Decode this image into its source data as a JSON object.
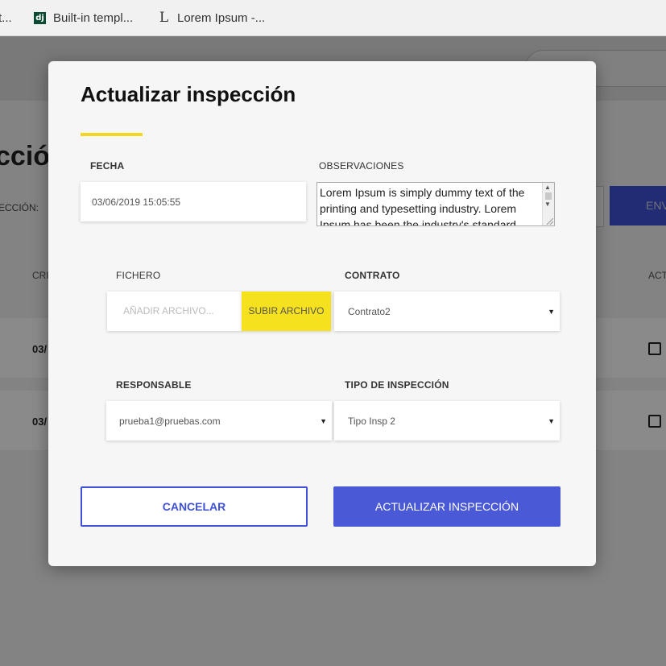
{
  "browser": {
    "bookmarks": [
      {
        "icon": "page-icon",
        "label": "t..."
      },
      {
        "icon": "django-icon",
        "label": "Built-in templ..."
      },
      {
        "icon": "lorem-ipsum-icon",
        "label": "Lorem Ipsum -..."
      }
    ]
  },
  "background_page": {
    "title_fragment": "cció",
    "filter_label_fragment": "ECCIÓN:",
    "send_button_fragment": "ENV",
    "column_fragments": [
      "CRI",
      "ACT"
    ],
    "row_dates": [
      "03/",
      "03/"
    ]
  },
  "modal": {
    "title": "Actualizar inspección",
    "accent_color": "#f2d61f",
    "fecha": {
      "label": "FECHA",
      "value": "03/06/2019 15:05:55"
    },
    "observaciones": {
      "label": "OBSERVACIONES",
      "value": "Lorem Ipsum is simply dummy text of the printing and typesetting industry. Lorem Ipsum has been the industry's standard"
    },
    "fichero": {
      "label": "FICHERO",
      "placeholder": "AÑADIR ARCHIVO...",
      "upload_label": "SUBIR ARCHIVO"
    },
    "contrato": {
      "label": "CONTRATO",
      "value": "Contrato2"
    },
    "responsable": {
      "label": "RESPONSABLE",
      "value": "prueba1@pruebas.com"
    },
    "tipo": {
      "label": "TIPO DE INSPECCIÓN",
      "value": "Tipo Insp 2"
    },
    "buttons": {
      "cancel": "CANCELAR",
      "update": "ACTUALIZAR INSPECCIÓN"
    },
    "primary_color": "#4a5ad6"
  }
}
